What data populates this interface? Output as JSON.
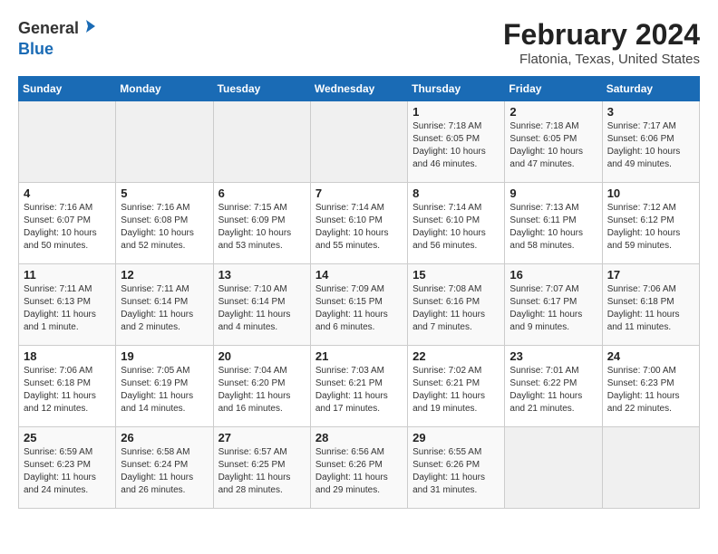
{
  "logo": {
    "line1": "General",
    "line2": "Blue"
  },
  "title": "February 2024",
  "subtitle": "Flatonia, Texas, United States",
  "days_of_week": [
    "Sunday",
    "Monday",
    "Tuesday",
    "Wednesday",
    "Thursday",
    "Friday",
    "Saturday"
  ],
  "weeks": [
    [
      {
        "day": "",
        "info": ""
      },
      {
        "day": "",
        "info": ""
      },
      {
        "day": "",
        "info": ""
      },
      {
        "day": "",
        "info": ""
      },
      {
        "day": "1",
        "info": "Sunrise: 7:18 AM\nSunset: 6:05 PM\nDaylight: 10 hours\nand 46 minutes."
      },
      {
        "day": "2",
        "info": "Sunrise: 7:18 AM\nSunset: 6:05 PM\nDaylight: 10 hours\nand 47 minutes."
      },
      {
        "day": "3",
        "info": "Sunrise: 7:17 AM\nSunset: 6:06 PM\nDaylight: 10 hours\nand 49 minutes."
      }
    ],
    [
      {
        "day": "4",
        "info": "Sunrise: 7:16 AM\nSunset: 6:07 PM\nDaylight: 10 hours\nand 50 minutes."
      },
      {
        "day": "5",
        "info": "Sunrise: 7:16 AM\nSunset: 6:08 PM\nDaylight: 10 hours\nand 52 minutes."
      },
      {
        "day": "6",
        "info": "Sunrise: 7:15 AM\nSunset: 6:09 PM\nDaylight: 10 hours\nand 53 minutes."
      },
      {
        "day": "7",
        "info": "Sunrise: 7:14 AM\nSunset: 6:10 PM\nDaylight: 10 hours\nand 55 minutes."
      },
      {
        "day": "8",
        "info": "Sunrise: 7:14 AM\nSunset: 6:10 PM\nDaylight: 10 hours\nand 56 minutes."
      },
      {
        "day": "9",
        "info": "Sunrise: 7:13 AM\nSunset: 6:11 PM\nDaylight: 10 hours\nand 58 minutes."
      },
      {
        "day": "10",
        "info": "Sunrise: 7:12 AM\nSunset: 6:12 PM\nDaylight: 10 hours\nand 59 minutes."
      }
    ],
    [
      {
        "day": "11",
        "info": "Sunrise: 7:11 AM\nSunset: 6:13 PM\nDaylight: 11 hours\nand 1 minute."
      },
      {
        "day": "12",
        "info": "Sunrise: 7:11 AM\nSunset: 6:14 PM\nDaylight: 11 hours\nand 2 minutes."
      },
      {
        "day": "13",
        "info": "Sunrise: 7:10 AM\nSunset: 6:14 PM\nDaylight: 11 hours\nand 4 minutes."
      },
      {
        "day": "14",
        "info": "Sunrise: 7:09 AM\nSunset: 6:15 PM\nDaylight: 11 hours\nand 6 minutes."
      },
      {
        "day": "15",
        "info": "Sunrise: 7:08 AM\nSunset: 6:16 PM\nDaylight: 11 hours\nand 7 minutes."
      },
      {
        "day": "16",
        "info": "Sunrise: 7:07 AM\nSunset: 6:17 PM\nDaylight: 11 hours\nand 9 minutes."
      },
      {
        "day": "17",
        "info": "Sunrise: 7:06 AM\nSunset: 6:18 PM\nDaylight: 11 hours\nand 11 minutes."
      }
    ],
    [
      {
        "day": "18",
        "info": "Sunrise: 7:06 AM\nSunset: 6:18 PM\nDaylight: 11 hours\nand 12 minutes."
      },
      {
        "day": "19",
        "info": "Sunrise: 7:05 AM\nSunset: 6:19 PM\nDaylight: 11 hours\nand 14 minutes."
      },
      {
        "day": "20",
        "info": "Sunrise: 7:04 AM\nSunset: 6:20 PM\nDaylight: 11 hours\nand 16 minutes."
      },
      {
        "day": "21",
        "info": "Sunrise: 7:03 AM\nSunset: 6:21 PM\nDaylight: 11 hours\nand 17 minutes."
      },
      {
        "day": "22",
        "info": "Sunrise: 7:02 AM\nSunset: 6:21 PM\nDaylight: 11 hours\nand 19 minutes."
      },
      {
        "day": "23",
        "info": "Sunrise: 7:01 AM\nSunset: 6:22 PM\nDaylight: 11 hours\nand 21 minutes."
      },
      {
        "day": "24",
        "info": "Sunrise: 7:00 AM\nSunset: 6:23 PM\nDaylight: 11 hours\nand 22 minutes."
      }
    ],
    [
      {
        "day": "25",
        "info": "Sunrise: 6:59 AM\nSunset: 6:23 PM\nDaylight: 11 hours\nand 24 minutes."
      },
      {
        "day": "26",
        "info": "Sunrise: 6:58 AM\nSunset: 6:24 PM\nDaylight: 11 hours\nand 26 minutes."
      },
      {
        "day": "27",
        "info": "Sunrise: 6:57 AM\nSunset: 6:25 PM\nDaylight: 11 hours\nand 28 minutes."
      },
      {
        "day": "28",
        "info": "Sunrise: 6:56 AM\nSunset: 6:26 PM\nDaylight: 11 hours\nand 29 minutes."
      },
      {
        "day": "29",
        "info": "Sunrise: 6:55 AM\nSunset: 6:26 PM\nDaylight: 11 hours\nand 31 minutes."
      },
      {
        "day": "",
        "info": ""
      },
      {
        "day": "",
        "info": ""
      }
    ]
  ]
}
